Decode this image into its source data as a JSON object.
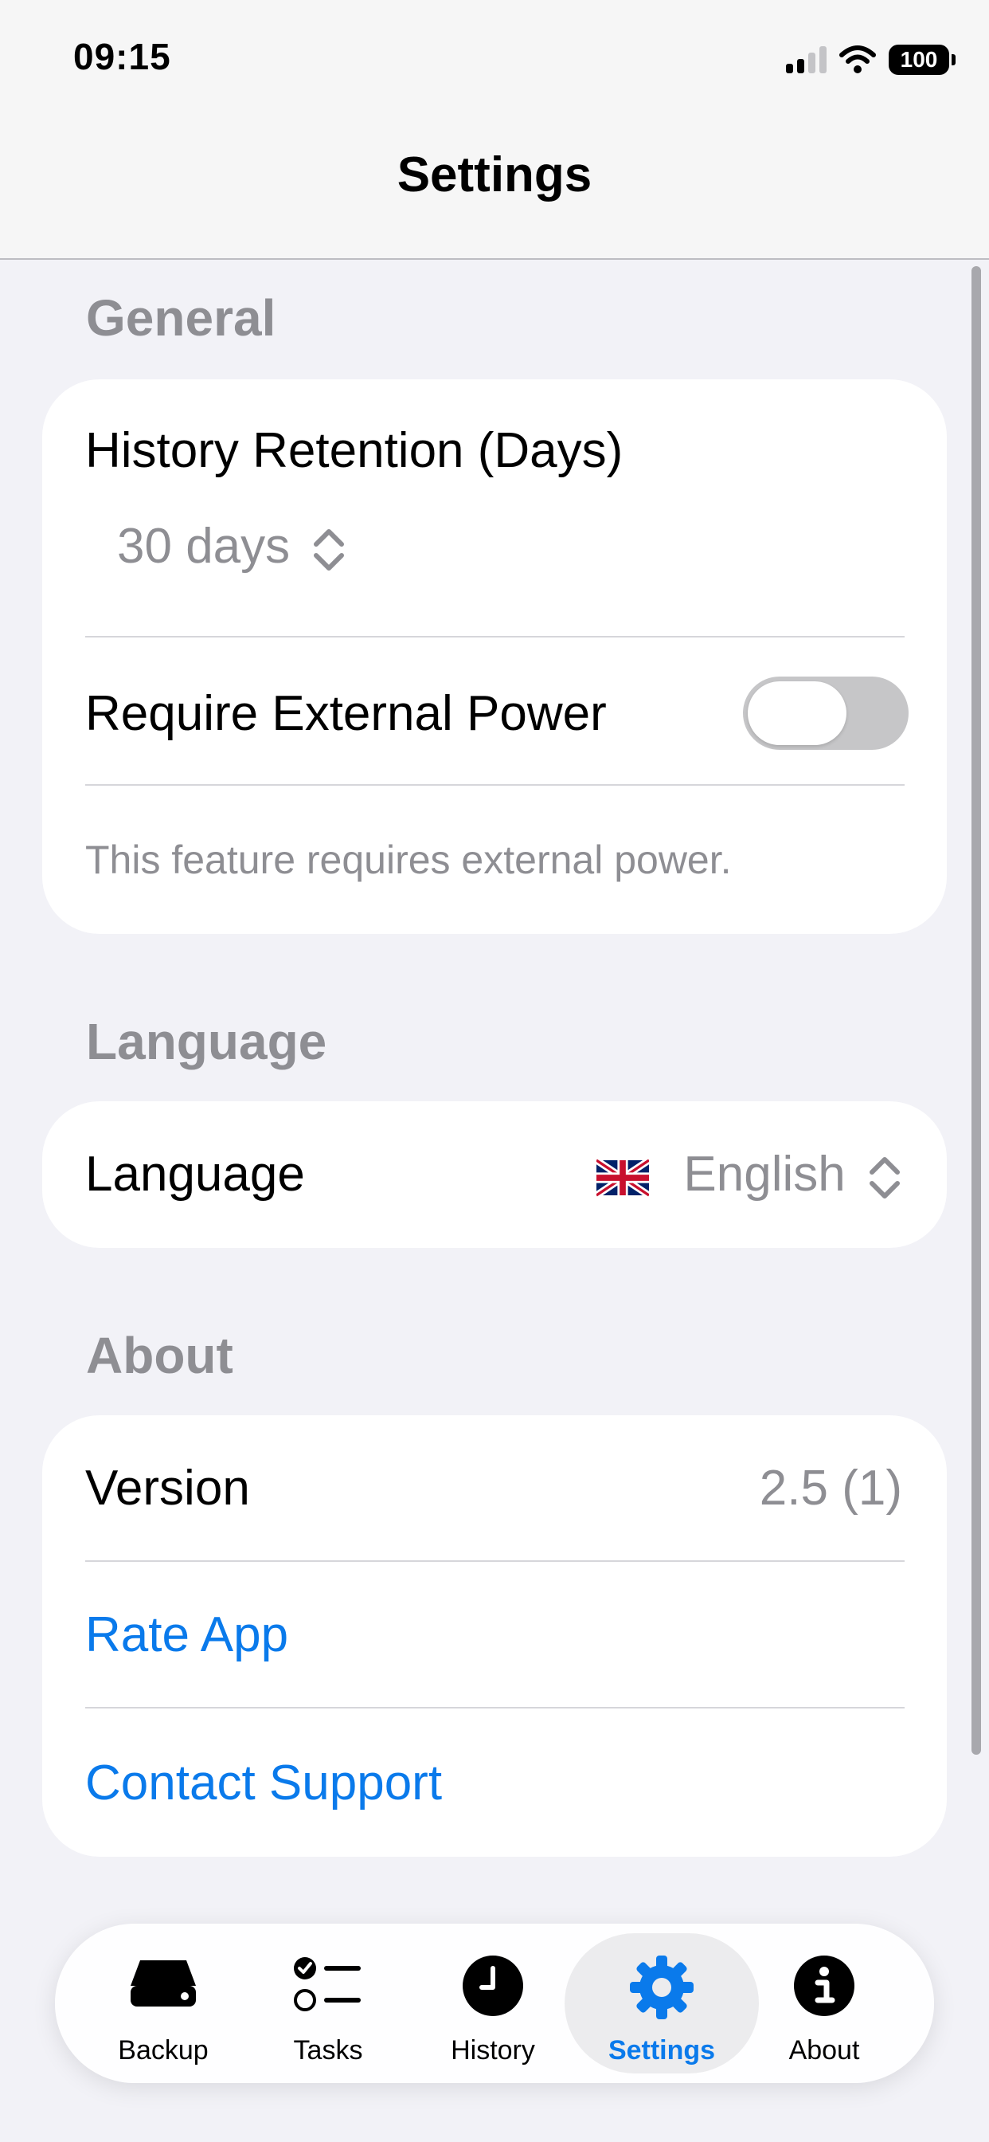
{
  "status_bar": {
    "time": "09:15",
    "battery": "100"
  },
  "nav": {
    "title": "Settings"
  },
  "sections": {
    "general": {
      "header": "General",
      "history_label": "History Retention (Days)",
      "history_value": "30 days",
      "power_label": "Require External Power",
      "power_enabled": false,
      "power_footer": "This feature requires external power."
    },
    "language": {
      "header": "Language",
      "label": "Language",
      "value": "English",
      "flag": "uk-flag-icon"
    },
    "about": {
      "header": "About",
      "version_label": "Version",
      "version_value": "2.5 (1)",
      "rate_label": "Rate App",
      "support_label": "Contact Support"
    }
  },
  "tabs": [
    {
      "label": "Backup",
      "icon": "drive-icon"
    },
    {
      "label": "Tasks",
      "icon": "checklist-icon"
    },
    {
      "label": "History",
      "icon": "clock-icon"
    },
    {
      "label": "Settings",
      "icon": "gear-icon",
      "active": true
    },
    {
      "label": "About",
      "icon": "info-icon"
    }
  ],
  "colors": {
    "accent": "#0a7aeb",
    "background": "#f2f2f7",
    "secondary": "#8e8e93"
  }
}
